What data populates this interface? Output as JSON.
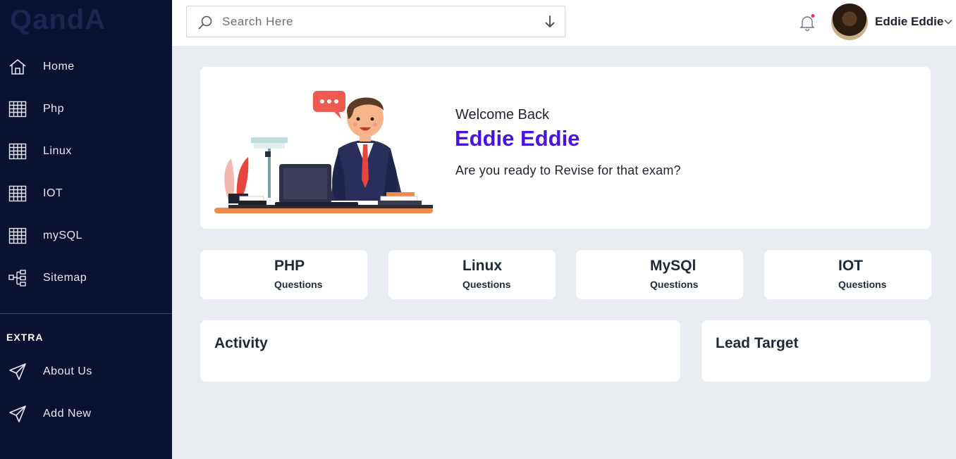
{
  "app": {
    "logo": "QandA"
  },
  "sidebar": {
    "items": [
      {
        "label": "Home",
        "icon": "home-icon"
      },
      {
        "label": "Php",
        "icon": "table-icon"
      },
      {
        "label": "Linux",
        "icon": "table-icon"
      },
      {
        "label": "IOT",
        "icon": "table-icon"
      },
      {
        "label": "mySQL",
        "icon": "table-icon"
      },
      {
        "label": "Sitemap",
        "icon": "sitemap-icon"
      }
    ],
    "extra_title": "EXTRA",
    "extra_items": [
      {
        "label": "About Us",
        "icon": "send-icon"
      },
      {
        "label": "Add New",
        "icon": "send-icon"
      }
    ]
  },
  "topbar": {
    "search_placeholder": "Search Here",
    "user_name": "Eddie Eddie",
    "icons": [
      "search-icon",
      "download-arrow-icon",
      "bell-icon",
      "chevron-down-icon"
    ]
  },
  "welcome": {
    "greeting": "Welcome Back",
    "name": "Eddie Eddie",
    "subtitle": "Are you ready to Revise for that exam?"
  },
  "question_cards": [
    {
      "title": "PHP",
      "subtitle": "Questions"
    },
    {
      "title": "Linux",
      "subtitle": "Questions"
    },
    {
      "title": "MySQl",
      "subtitle": "Questions"
    },
    {
      "title": "IOT",
      "subtitle": "Questions"
    }
  ],
  "panels": {
    "activity_title": "Activity",
    "lead_target_title": "Lead Target"
  },
  "colors": {
    "sidebar_bg": "#0b1130",
    "accent": "#4a12e0",
    "page_bg": "#e9edf2",
    "notification_dot": "#e8336d"
  }
}
